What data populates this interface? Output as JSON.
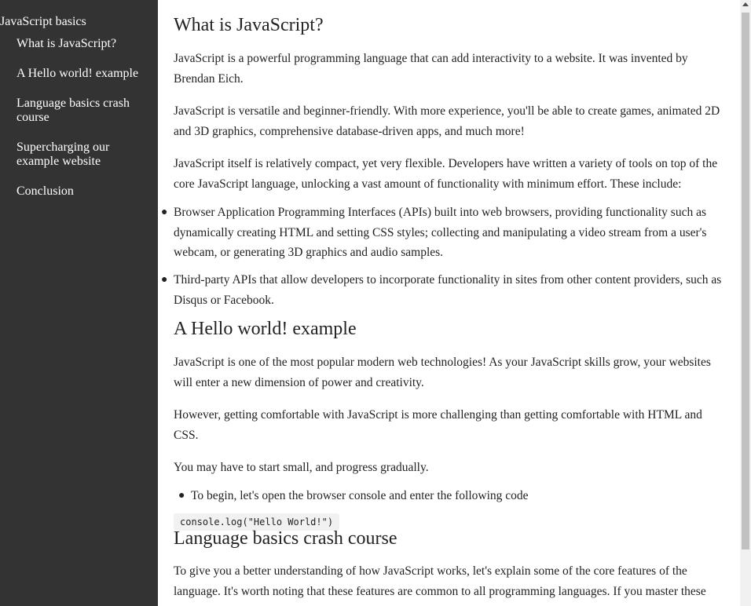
{
  "sidebar": {
    "title": "JavaScript basics",
    "items": [
      {
        "label": "What is JavaScript?"
      },
      {
        "label": "A Hello world! example"
      },
      {
        "label": "Language basics crash course"
      },
      {
        "label": "Supercharging our example website"
      },
      {
        "label": "Conclusion"
      }
    ]
  },
  "main": {
    "section1": {
      "heading": "What is JavaScript?",
      "p1": "JavaScript is a powerful programming language that can add interactivity to a website. It was invented by Brendan Eich.",
      "p2": "JavaScript is versatile and beginner-friendly. With more experience, you'll be able to create games, animated 2D and 3D graphics, comprehensive database-driven apps, and much more!",
      "p3": "JavaScript itself is relatively compact, yet very flexible. Developers have written a variety of tools on top of the core JavaScript language, unlocking a vast amount of functionality with minimum effort. These include:",
      "bullets": [
        "Browser Application Programming Interfaces (APIs) built into web browsers, providing functionality such as dynamically creating HTML and setting CSS styles; collecting and manipulating a video stream from a user's webcam, or generating 3D graphics and audio samples.",
        "Third-party APIs that allow developers to incorporate functionality in sites from other content providers, such as Disqus or Facebook."
      ]
    },
    "section2": {
      "heading": "A Hello world! example",
      "p1": "JavaScript is one of the most popular modern web technologies! As your JavaScript skills grow, your websites will enter a new dimension of power and creativity.",
      "p2": "However, getting comfortable with JavaScript is more challenging than getting comfortable with HTML and CSS.",
      "p3": "You may have to start small, and progress gradually.",
      "bullet": "To begin, let's open the browser console and enter the following code",
      "code": "console.log(\"Hello World!\")"
    },
    "section3": {
      "heading": "Language basics crash course",
      "p1": "To give you a better understanding of how JavaScript works, let's explain some of the core features of the language. It's worth noting that these features are common to all programming languages. If you master these"
    }
  },
  "colors": {
    "sidebar_bg": "#333333",
    "sidebar_text": "#ffffff",
    "body_text": "#222222",
    "code_bg": "#f1f1f1",
    "scrollbar_track": "#f1f1f1",
    "scrollbar_thumb": "#c1c1c1"
  }
}
